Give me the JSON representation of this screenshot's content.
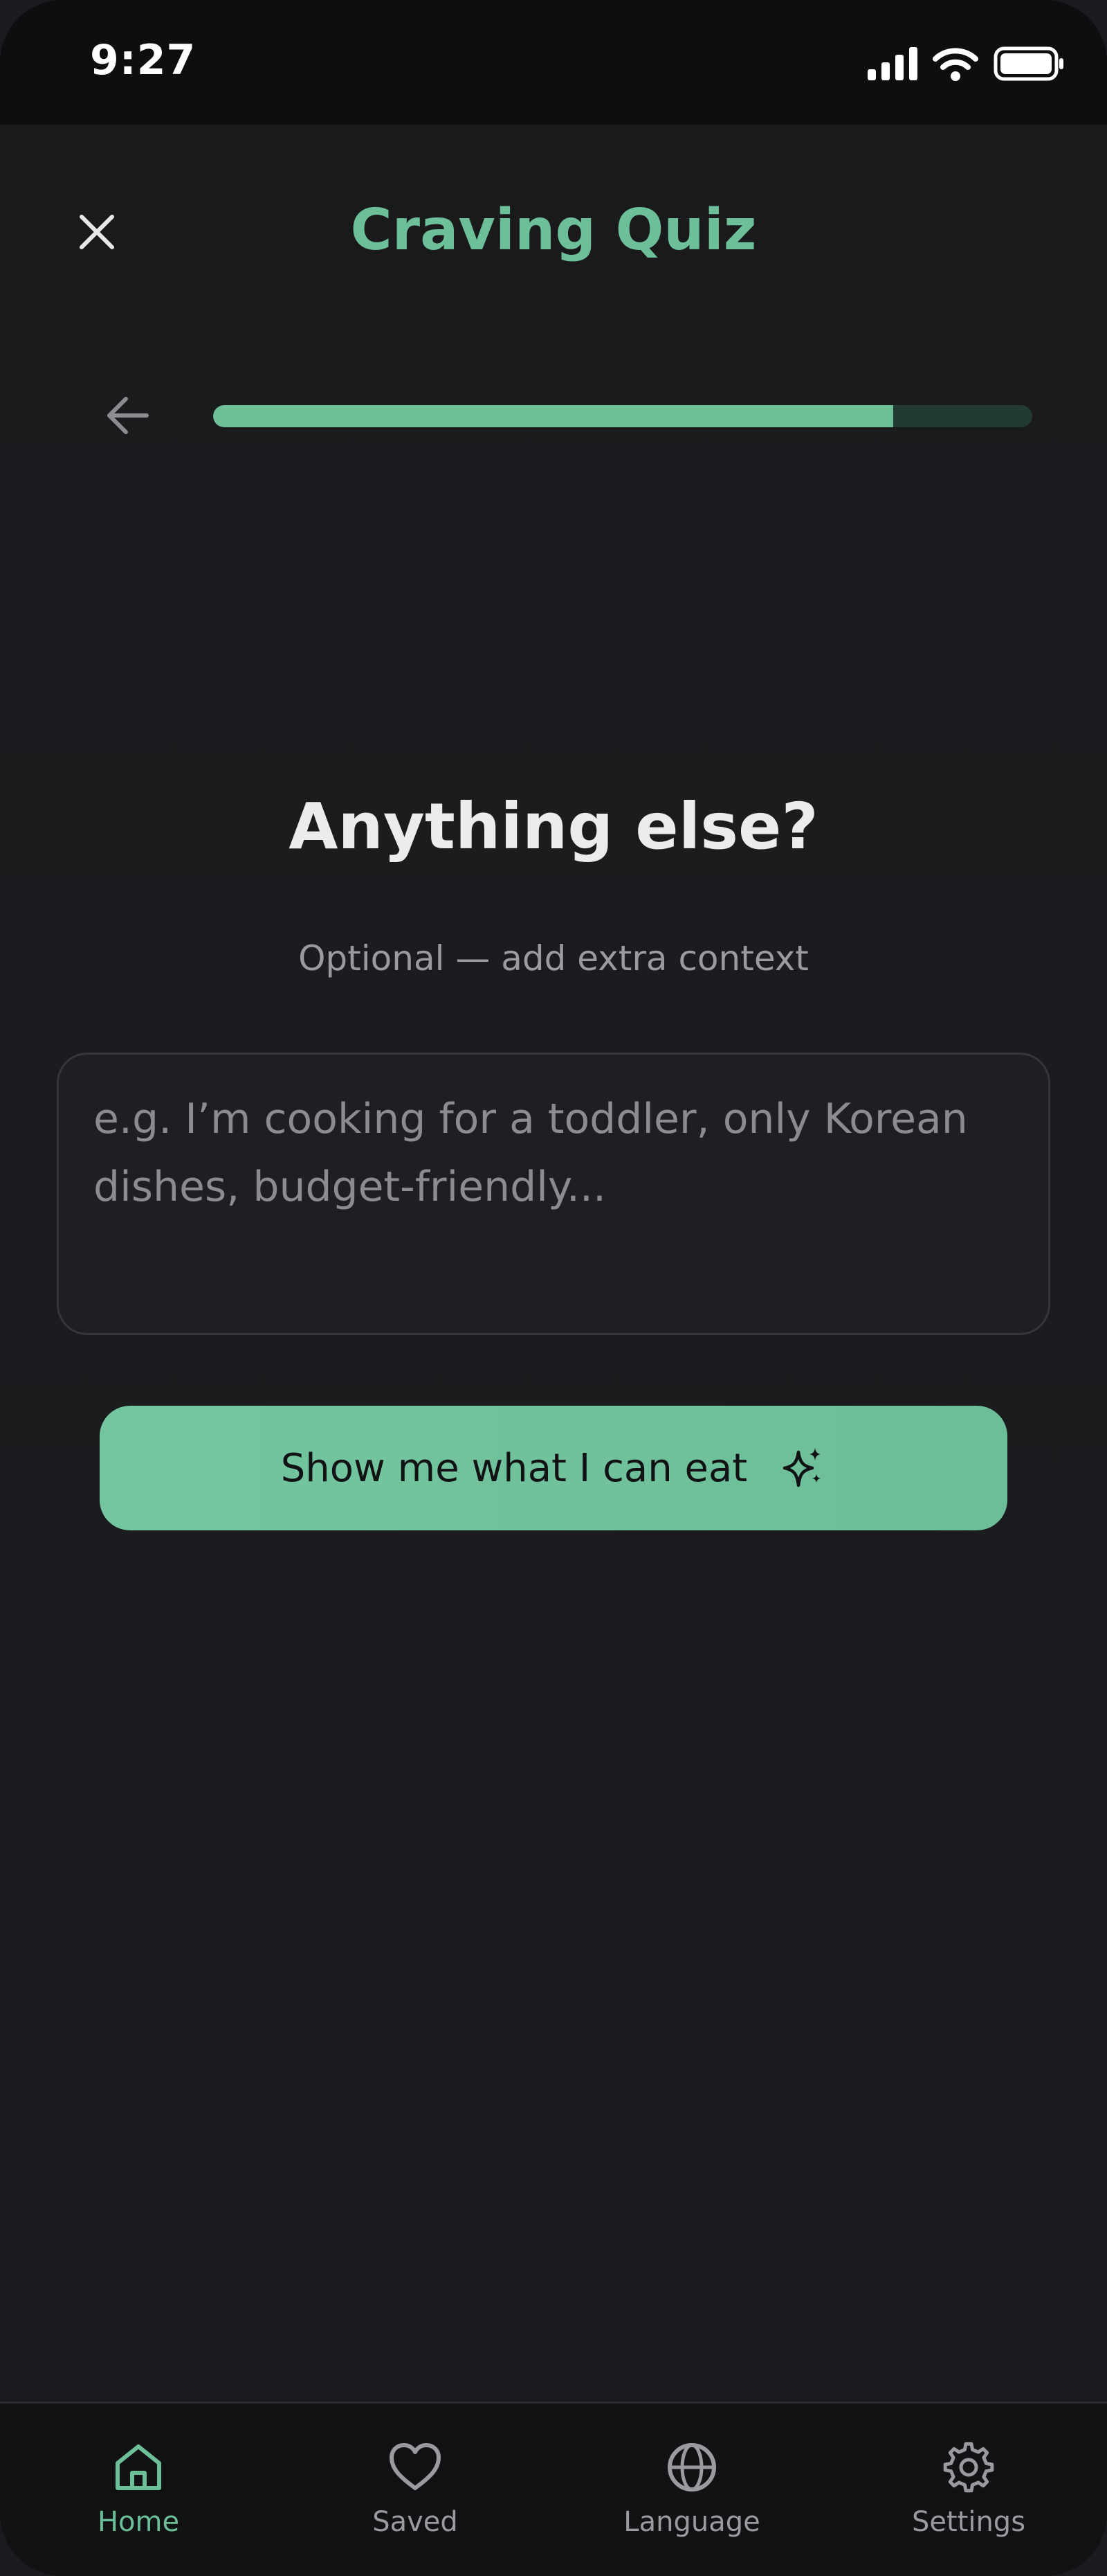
{
  "status_bar": {
    "time": "9:27"
  },
  "header": {
    "title": "Craving Quiz"
  },
  "progress": {
    "fraction": 0.83
  },
  "question": {
    "title": "Anything else?",
    "subtitle": "Optional — add extra context"
  },
  "context_input": {
    "value": "",
    "placeholder": "e.g. I’m cooking for a toddler, only Korean dishes, budget-friendly..."
  },
  "cta": {
    "label": "Show me what I can eat"
  },
  "bottom_nav": {
    "items": [
      {
        "label": "Home",
        "icon": "home-icon",
        "active": true
      },
      {
        "label": "Saved",
        "icon": "heart-icon",
        "active": false
      },
      {
        "label": "Language",
        "icon": "globe-icon",
        "active": false
      },
      {
        "label": "Settings",
        "icon": "gear-icon",
        "active": false
      }
    ]
  },
  "colors": {
    "accent": "#6cbf98",
    "background": "#1a1b1e",
    "status_bar": "#0c0e10",
    "nav_bar": "#111214",
    "progress_track": "#223a2f"
  }
}
